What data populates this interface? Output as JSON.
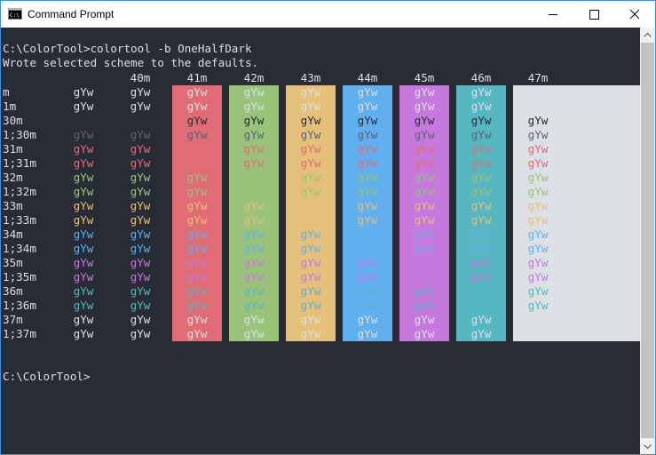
{
  "window": {
    "title": "Command Prompt",
    "app_icon": "cmd-icon"
  },
  "controls": {
    "minimize_icon": "minimize-icon",
    "maximize_icon": "maximize-icon",
    "close_icon": "close-icon"
  },
  "console": {
    "background": "#282c34",
    "line1": "C:\\ColorTool>colortool -b OneHalfDark",
    "line2": "Wrote selected scheme to the defaults.",
    "prompt": "C:\\ColorTool>"
  },
  "headers": [
    "40m",
    "41m",
    "42m",
    "43m",
    "44m",
    "45m",
    "46m",
    "47m"
  ],
  "row_labels": [
    "m",
    "1m",
    "30m",
    "1;30m",
    "31m",
    "1;31m",
    "32m",
    "1;32m",
    "33m",
    "1;33m",
    "34m",
    "1;34m",
    "35m",
    "1;35m",
    "36m",
    "1;36m",
    "37m",
    "1;37m"
  ],
  "sample": "gYw",
  "palette": {
    "black": "#282c34",
    "bright_black": "#5a6374",
    "red": "#e06c75",
    "green": "#98c379",
    "yellow": "#e5c07b",
    "blue": "#61afef",
    "magenta": "#c678dd",
    "cyan": "#56b6c2",
    "white": "#dcdfe4",
    "default_fg": "#dcdfe4"
  },
  "bg_colors": [
    "#e06c75",
    "#98c379",
    "#e5c07b",
    "#61afef",
    "#c678dd",
    "#56b6c2",
    "#dcdfe4"
  ]
}
